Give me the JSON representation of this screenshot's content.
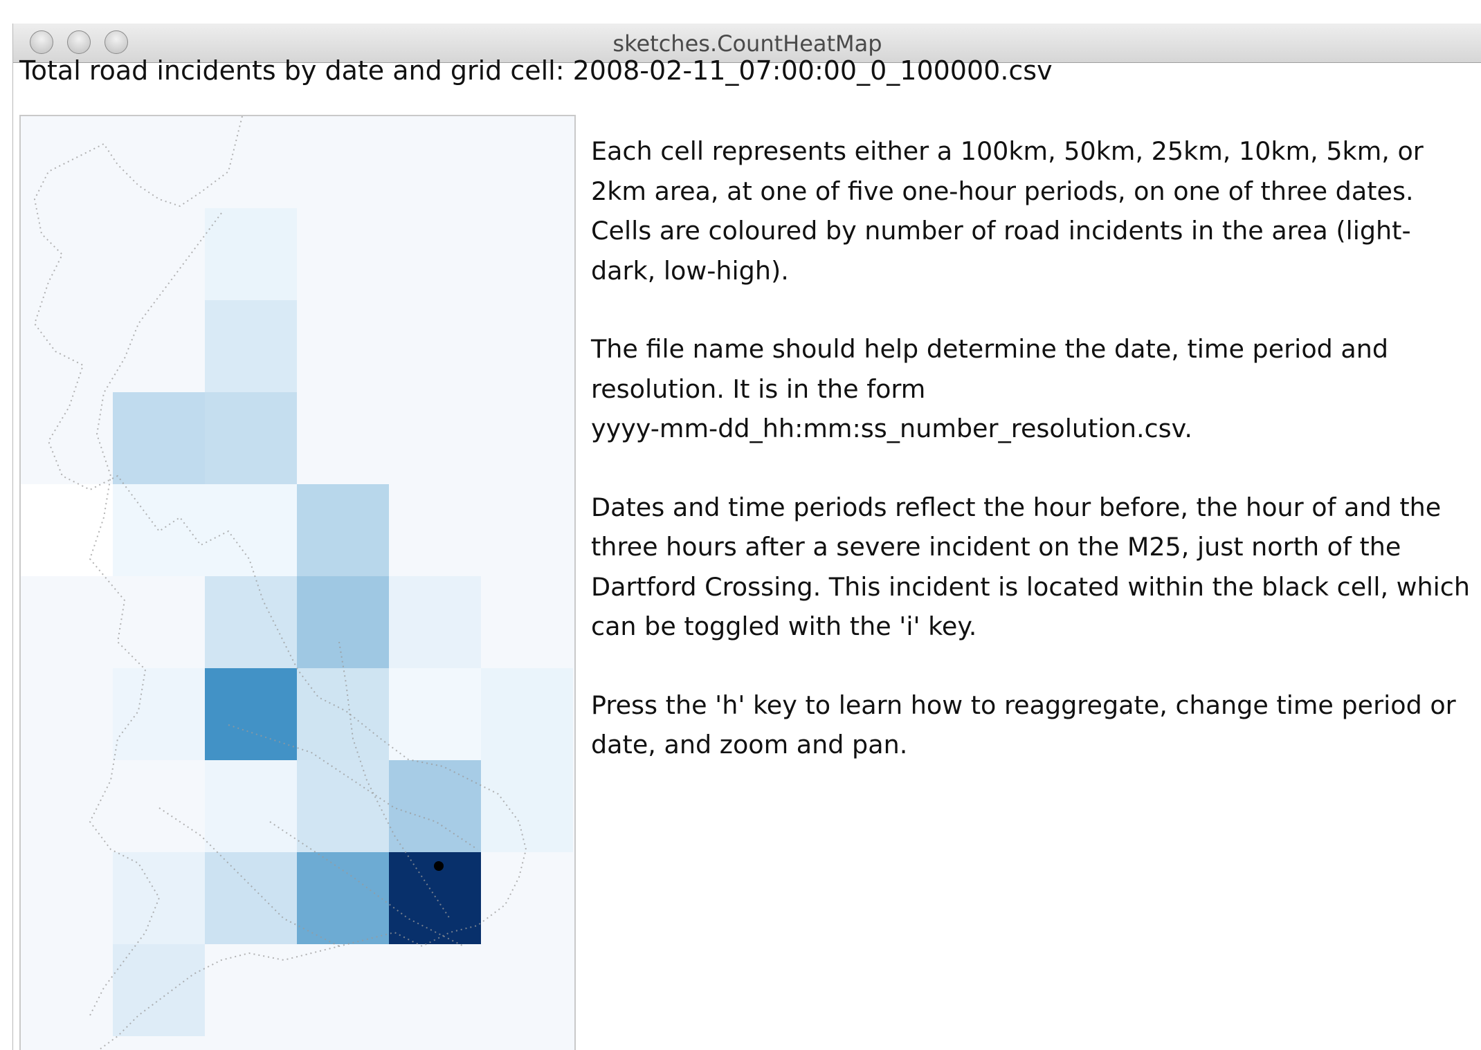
{
  "window": {
    "title": "sketches.CountHeatMap",
    "controls": [
      "close-button",
      "minimize-button",
      "zoom-button"
    ]
  },
  "heading": "Total road incidents by date and grid cell: 2008-02-11_07:00:00_0_100000.csv",
  "description": {
    "p1": "Each cell represents either a 100km, 50km, 25km, 10km, 5km, or 2km area, at one of five one-hour periods, on one of three dates. Cells are coloured by number of road incidents in the area (light-dark, low-high).",
    "p2_line1": "The file name should help determine the date, time period and resolution. It is in the form",
    "p2_line2": "yyyy-mm-dd_hh:mm:ss_number_resolution.csv.",
    "p3": "Dates and time periods reflect the hour before, the hour of and the three hours after a severe incident on the M25, just north of the Dartford Crossing. This incident is located within the black cell, which can be toggled with the 'i' key.",
    "p4": "Press the 'h' key to learn how to reaggregate, change time period or date, and zoom and pan."
  },
  "colors": {
    "background": "#f5f8fc",
    "low": "#f7fbff",
    "high": "#08306b",
    "outline": "#9a9a9a"
  },
  "chart_data": {
    "type": "heatmap",
    "columns": 6,
    "rows": 10,
    "resolution_km": 100,
    "date_time": "2008-02-11 07:00:00",
    "cells": [
      {
        "col": 2,
        "row": 1,
        "value": 0.05
      },
      {
        "col": 2,
        "row": 2,
        "value": 0.12
      },
      {
        "col": 1,
        "row": 3,
        "value": 0.22
      },
      {
        "col": 2,
        "row": 3,
        "value": 0.2
      },
      {
        "col": 0,
        "row": 4,
        "value": 0.0
      },
      {
        "col": 1,
        "row": 4,
        "value": 0.03
      },
      {
        "col": 2,
        "row": 4,
        "value": 0.03
      },
      {
        "col": 3,
        "row": 4,
        "value": 0.25
      },
      {
        "col": 2,
        "row": 5,
        "value": 0.15
      },
      {
        "col": 3,
        "row": 5,
        "value": 0.35
      },
      {
        "col": 4,
        "row": 5,
        "value": 0.06
      },
      {
        "col": 1,
        "row": 6,
        "value": 0.04
      },
      {
        "col": 2,
        "row": 6,
        "value": 0.72
      },
      {
        "col": 3,
        "row": 6,
        "value": 0.16
      },
      {
        "col": 4,
        "row": 6,
        "value": 0.02
      },
      {
        "col": 5,
        "row": 6,
        "value": 0.05
      },
      {
        "col": 2,
        "row": 7,
        "value": 0.04
      },
      {
        "col": 3,
        "row": 7,
        "value": 0.15
      },
      {
        "col": 4,
        "row": 7,
        "value": 0.32
      },
      {
        "col": 5,
        "row": 7,
        "value": 0.05
      },
      {
        "col": 1,
        "row": 8,
        "value": 0.06
      },
      {
        "col": 2,
        "row": 8,
        "value": 0.17
      },
      {
        "col": 3,
        "row": 8,
        "value": 0.55
      },
      {
        "col": 4,
        "row": 8,
        "value": 1.0
      },
      {
        "col": 1,
        "row": 9,
        "value": 0.1
      }
    ],
    "incident_cell": {
      "col": 4,
      "row": 8
    }
  }
}
